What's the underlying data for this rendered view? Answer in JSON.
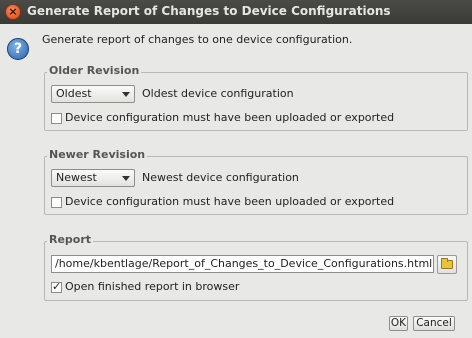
{
  "window": {
    "title": "Generate Report of Changes to Device Configurations"
  },
  "intro": "Generate report of changes to one device configuration.",
  "older": {
    "legend": "Older Revision",
    "select_value": "Oldest",
    "select_label": "Oldest device configuration",
    "checkbox_label": "Device configuration must have been uploaded or exported",
    "checkbox_checked": false
  },
  "newer": {
    "legend": "Newer Revision",
    "select_value": "Newest",
    "select_label": "Newest device configuration",
    "checkbox_label": "Device configuration must have been uploaded or exported",
    "checkbox_checked": false
  },
  "report": {
    "legend": "Report",
    "path": "/home/kbentlage/Report_of_Changes_to_Device_Configurations.html",
    "open_label": "Open finished report in browser",
    "open_checked": true
  },
  "buttons": {
    "ok": "OK",
    "cancel": "Cancel"
  },
  "icons": {
    "close": "close-icon",
    "help": "help-icon",
    "folder": "folder-icon"
  },
  "colors": {
    "titlebar": "#3f3f3c",
    "close": "#e55b2a",
    "help": "#3a6fb3"
  }
}
